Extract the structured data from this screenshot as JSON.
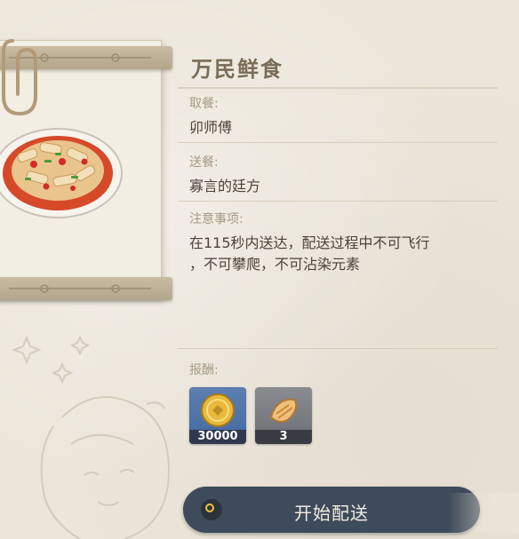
{
  "panel": {
    "title": "万民鲜食",
    "pickup_label": "取餐:",
    "pickup_value": "卯师傅",
    "delivery_label": "送餐:",
    "delivery_value": "寡言的廷方",
    "notes_label": "注意事项:",
    "notes_line1": "在115秒内送达，配送过程中不可飞行",
    "notes_line2": "，不可攀爬，不可沾染元素",
    "rewards_label": "报酬:"
  },
  "rewards": [
    {
      "icon": "mora-coin-icon",
      "count": "30000",
      "background": "#4f72aa"
    },
    {
      "icon": "food-dish-icon",
      "count": "3",
      "background": "#7b7e84"
    }
  ],
  "actions": {
    "start_label": "开始配送"
  },
  "colors": {
    "title": "#7a6c58",
    "label": "#a79a84",
    "value": "#4b4339",
    "button": "#3e4b5a",
    "button_ring": "#f0c23a",
    "background": "#ece6da"
  }
}
